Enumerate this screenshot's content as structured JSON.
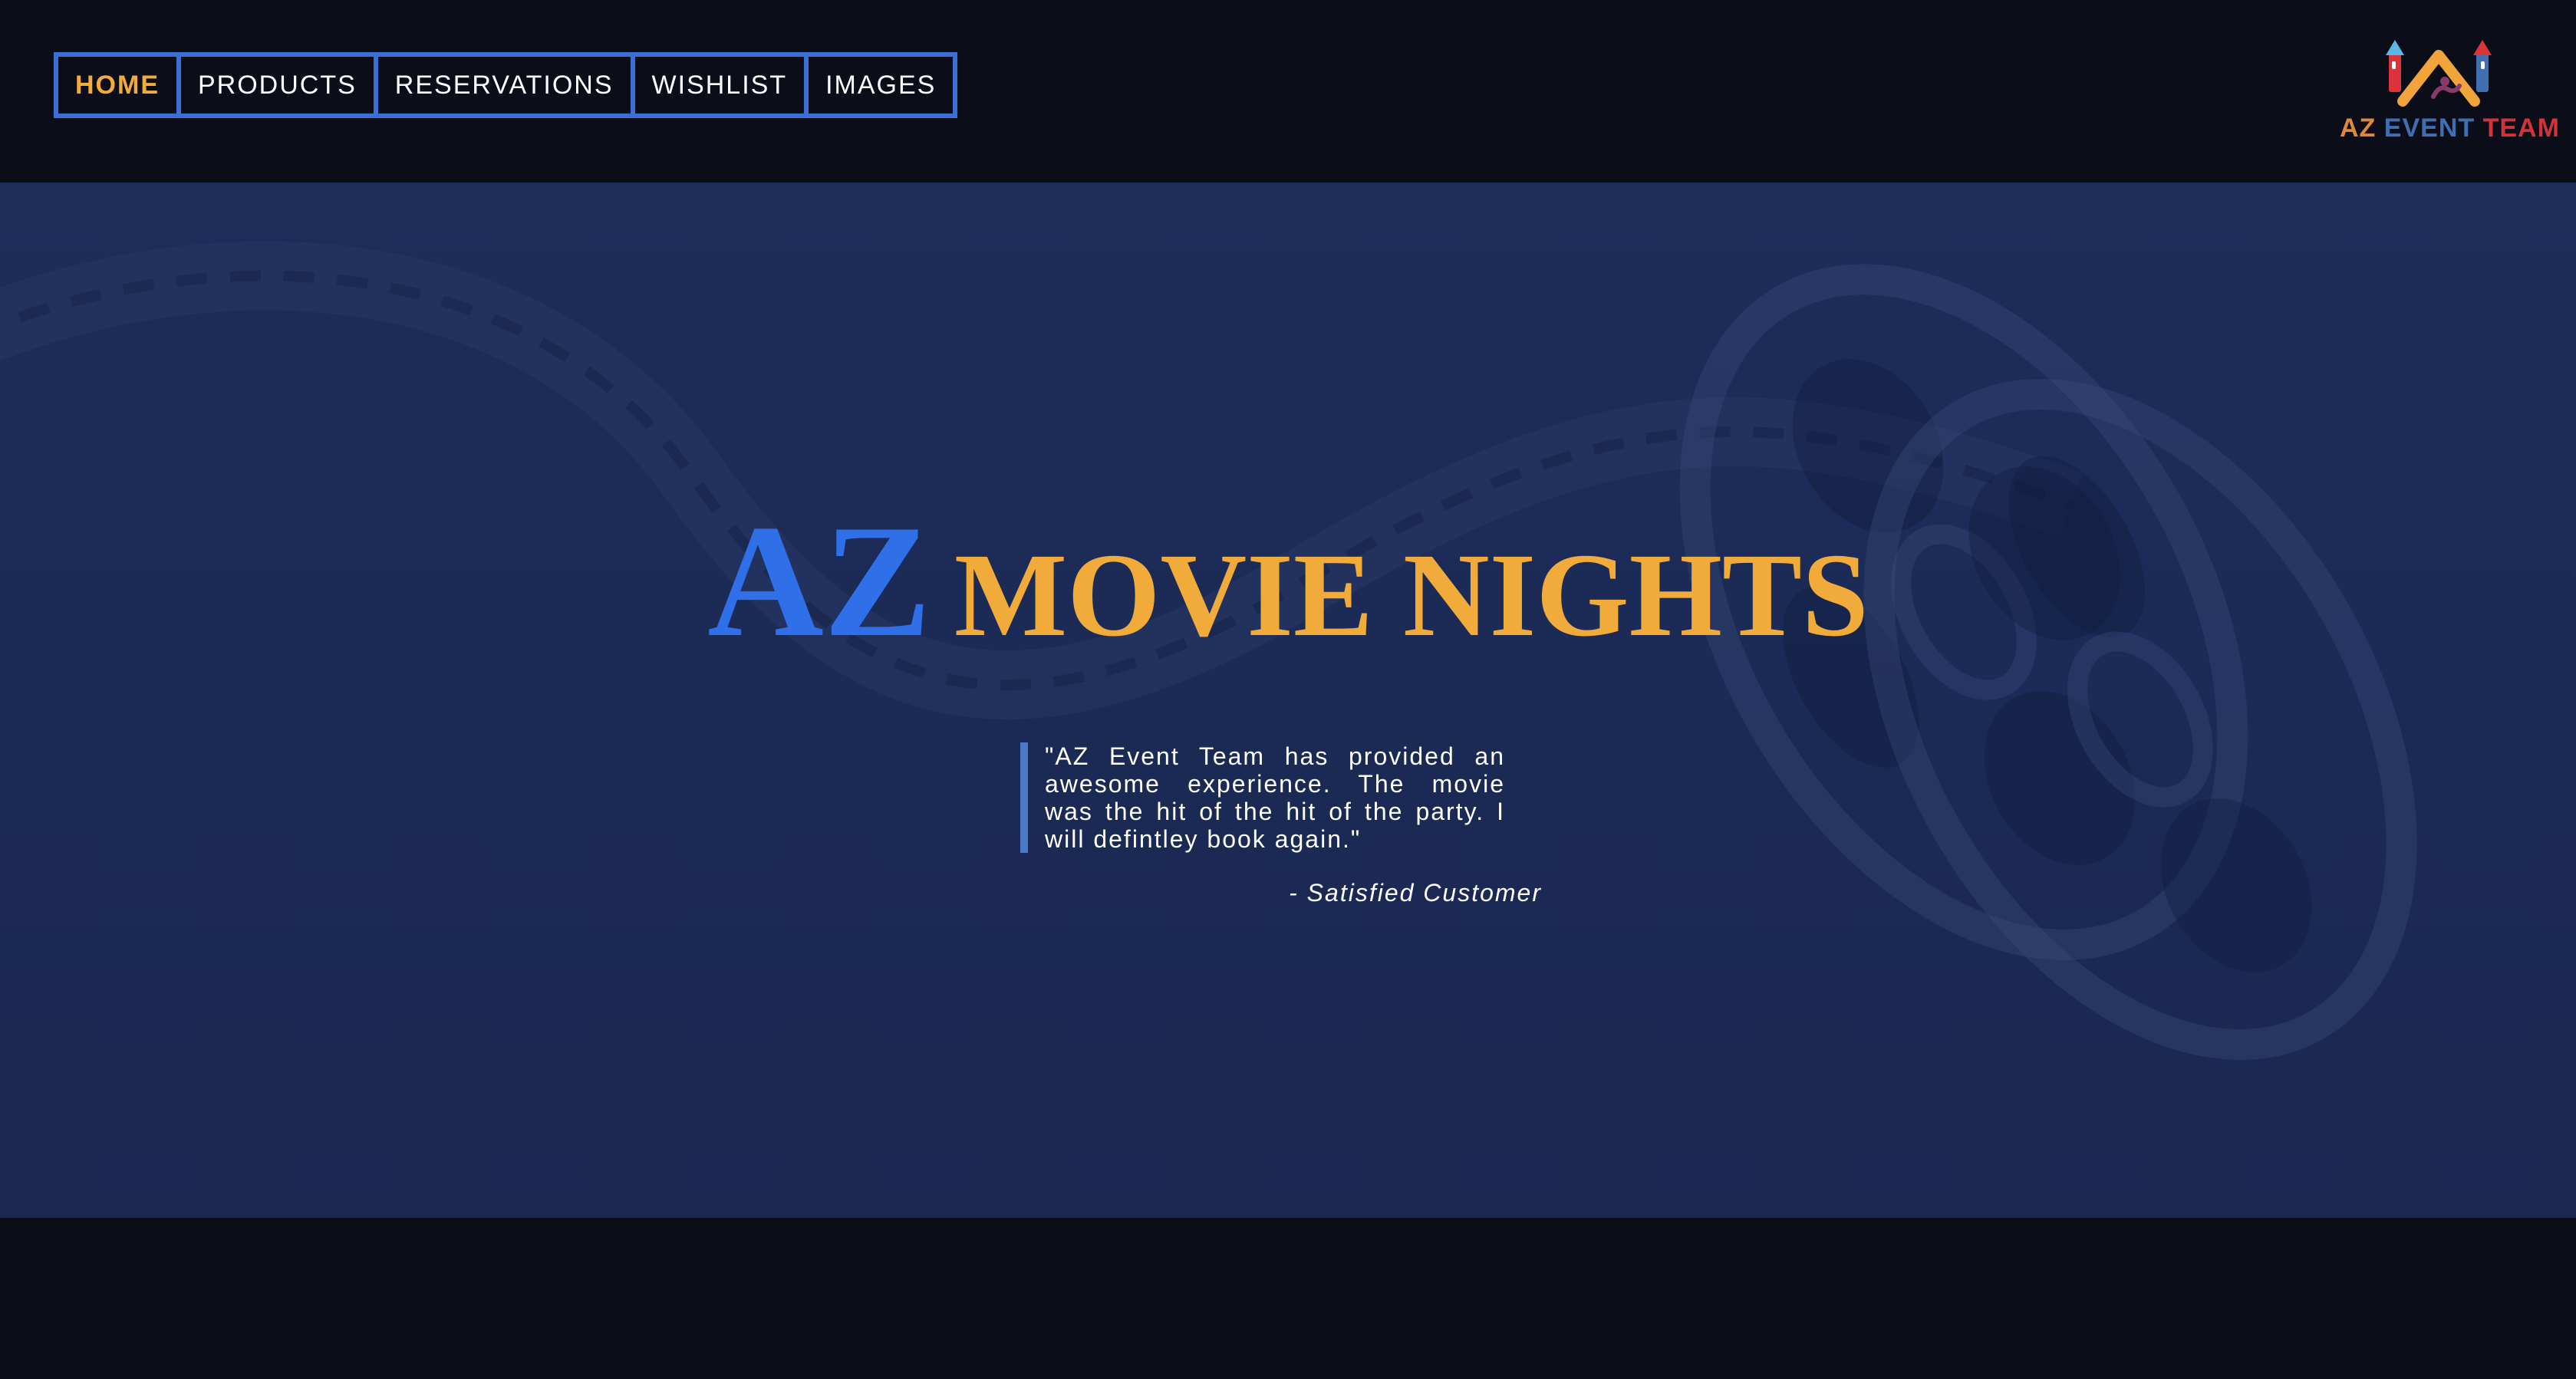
{
  "nav": {
    "items": [
      {
        "label": "HOME",
        "active": true
      },
      {
        "label": "PRODUCTS",
        "active": false
      },
      {
        "label": "RESERVATIONS",
        "active": false
      },
      {
        "label": "WISHLIST",
        "active": false
      },
      {
        "label": "IMAGES",
        "active": false
      }
    ]
  },
  "logo": {
    "text_1": "AZ",
    "text_2": "EVENT",
    "text_3": "TEAM",
    "icon": "bounce-castle-icon"
  },
  "hero": {
    "title_az": "AZ",
    "title_rest": "MOVIE NIGHTS",
    "background_icon": "film-reel-icon"
  },
  "testimonial": {
    "quote": "\"AZ Event Team has provided an awesome experience. The movie was the hit of the hit of the party. I will defintley book again.\"",
    "author": "- Satisfied Customer"
  },
  "colors": {
    "accent_blue": "#2f6fe8",
    "accent_orange": "#f0ab3b",
    "nav_border": "#3a6fd6",
    "page_bg": "#0b0d19",
    "hero_bg": "#1c2b57"
  }
}
